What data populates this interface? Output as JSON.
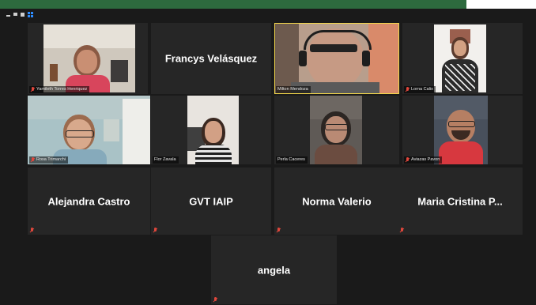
{
  "window": {
    "accent": "#2d6a3e"
  },
  "view_toolbar": {
    "icons": [
      "minimize-icon",
      "restore-icon",
      "fullscreen-icon",
      "gallery-view-icon"
    ]
  },
  "participants": [
    {
      "id": "yamileth",
      "name_label": "Yamileth Torres Henriquez",
      "muted": true,
      "video": true
    },
    {
      "id": "francys",
      "display_name": "Francys Velásquez",
      "muted": false,
      "video": false
    },
    {
      "id": "milton",
      "name_label": "Milton Mendoza",
      "muted": false,
      "video": true,
      "active_speaker": true
    },
    {
      "id": "lorna",
      "name_label": "Lorna Calix",
      "muted": true,
      "video": true
    },
    {
      "id": "rosa",
      "name_label": "Rosa Trimarchi",
      "muted": true,
      "video": true
    },
    {
      "id": "flor",
      "name_label": "Flor Zavala",
      "muted": false,
      "video": true
    },
    {
      "id": "perla",
      "name_label": "Perla Caceres",
      "muted": false,
      "video": true
    },
    {
      "id": "aviazas",
      "name_label": "Aviazas Pavon",
      "muted": true,
      "video": true
    },
    {
      "id": "alejandra",
      "display_name": "Alejandra Castro",
      "muted": true,
      "video": false
    },
    {
      "id": "gvt",
      "display_name": "GVT IAIP",
      "muted": true,
      "video": false
    },
    {
      "id": "norma",
      "display_name": "Norma Valerio",
      "muted": true,
      "video": false
    },
    {
      "id": "maria",
      "display_name": "Maria Cristina P...",
      "muted": true,
      "video": false
    },
    {
      "id": "angela",
      "display_name": "angela",
      "muted": true,
      "video": false
    }
  ]
}
